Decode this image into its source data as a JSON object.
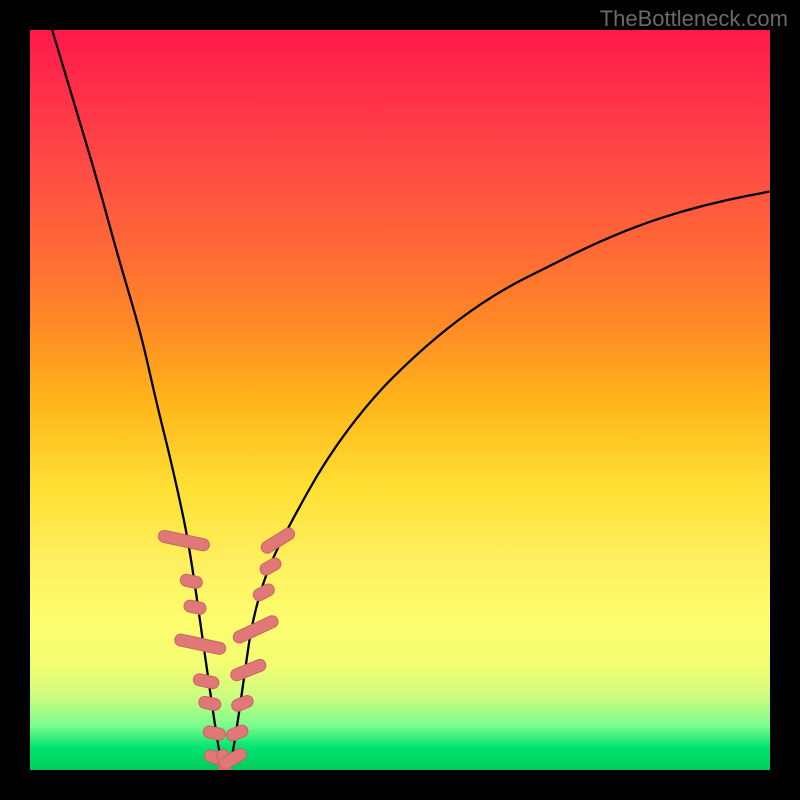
{
  "attribution": "TheBottleneck.com",
  "colors": {
    "black": "#000000",
    "marker_fill": "#e07878",
    "marker_stroke": "#c96565"
  },
  "chart_data": {
    "type": "line",
    "title": "",
    "xlabel": "",
    "ylabel": "",
    "xlim": [
      0,
      100
    ],
    "ylim": [
      0,
      100
    ],
    "grid": false,
    "legend": false,
    "note": "V-shaped bottleneck curve; y is percent-like metric, x nominal axis. Values estimated from pixels (no ticks shown).",
    "series": [
      {
        "name": "curve",
        "x": [
          3,
          6,
          9,
          12,
          15,
          17,
          19,
          21,
          22,
          23,
          24,
          25,
          26,
          27,
          28,
          29,
          30,
          32,
          35,
          40,
          46,
          52,
          58,
          64,
          70,
          76,
          82,
          88,
          94,
          100
        ],
        "y": [
          100,
          90,
          80,
          69,
          59,
          50,
          42,
          33,
          27,
          20,
          13,
          6,
          0,
          0,
          6,
          13,
          20,
          27,
          33,
          42,
          50,
          56,
          61,
          65,
          68,
          71,
          73.5,
          75.5,
          77,
          78.2
        ]
      }
    ],
    "markers": {
      "name": "dotted-segments",
      "note": "Salmon rounded segments along lower curve flanks near trough.",
      "points": [
        {
          "x": 20.8,
          "y": 31,
          "len": 7,
          "angle": -78
        },
        {
          "x": 21.8,
          "y": 25.5,
          "len": 3,
          "angle": -78
        },
        {
          "x": 22.3,
          "y": 22,
          "len": 3,
          "angle": -78
        },
        {
          "x": 23.0,
          "y": 17,
          "len": 7,
          "angle": -78
        },
        {
          "x": 23.8,
          "y": 12,
          "len": 3.5,
          "angle": -78
        },
        {
          "x": 24.3,
          "y": 9,
          "len": 3,
          "angle": -78
        },
        {
          "x": 24.9,
          "y": 5,
          "len": 3,
          "angle": -78
        },
        {
          "x": 25.5,
          "y": 1.5,
          "len": 4,
          "angle": -70
        },
        {
          "x": 26.3,
          "y": 0.3,
          "len": 5,
          "angle": -8
        },
        {
          "x": 27.4,
          "y": 1.5,
          "len": 4,
          "angle": 60
        },
        {
          "x": 28.0,
          "y": 5,
          "len": 3,
          "angle": 68
        },
        {
          "x": 28.7,
          "y": 9,
          "len": 3,
          "angle": 68
        },
        {
          "x": 29.5,
          "y": 13.5,
          "len": 5,
          "angle": 68
        },
        {
          "x": 30.5,
          "y": 19,
          "len": 6.5,
          "angle": 65
        },
        {
          "x": 31.6,
          "y": 24,
          "len": 3,
          "angle": 62
        },
        {
          "x": 32.5,
          "y": 27.5,
          "len": 3,
          "angle": 60
        },
        {
          "x": 33.5,
          "y": 31,
          "len": 5,
          "angle": 58
        }
      ]
    }
  }
}
